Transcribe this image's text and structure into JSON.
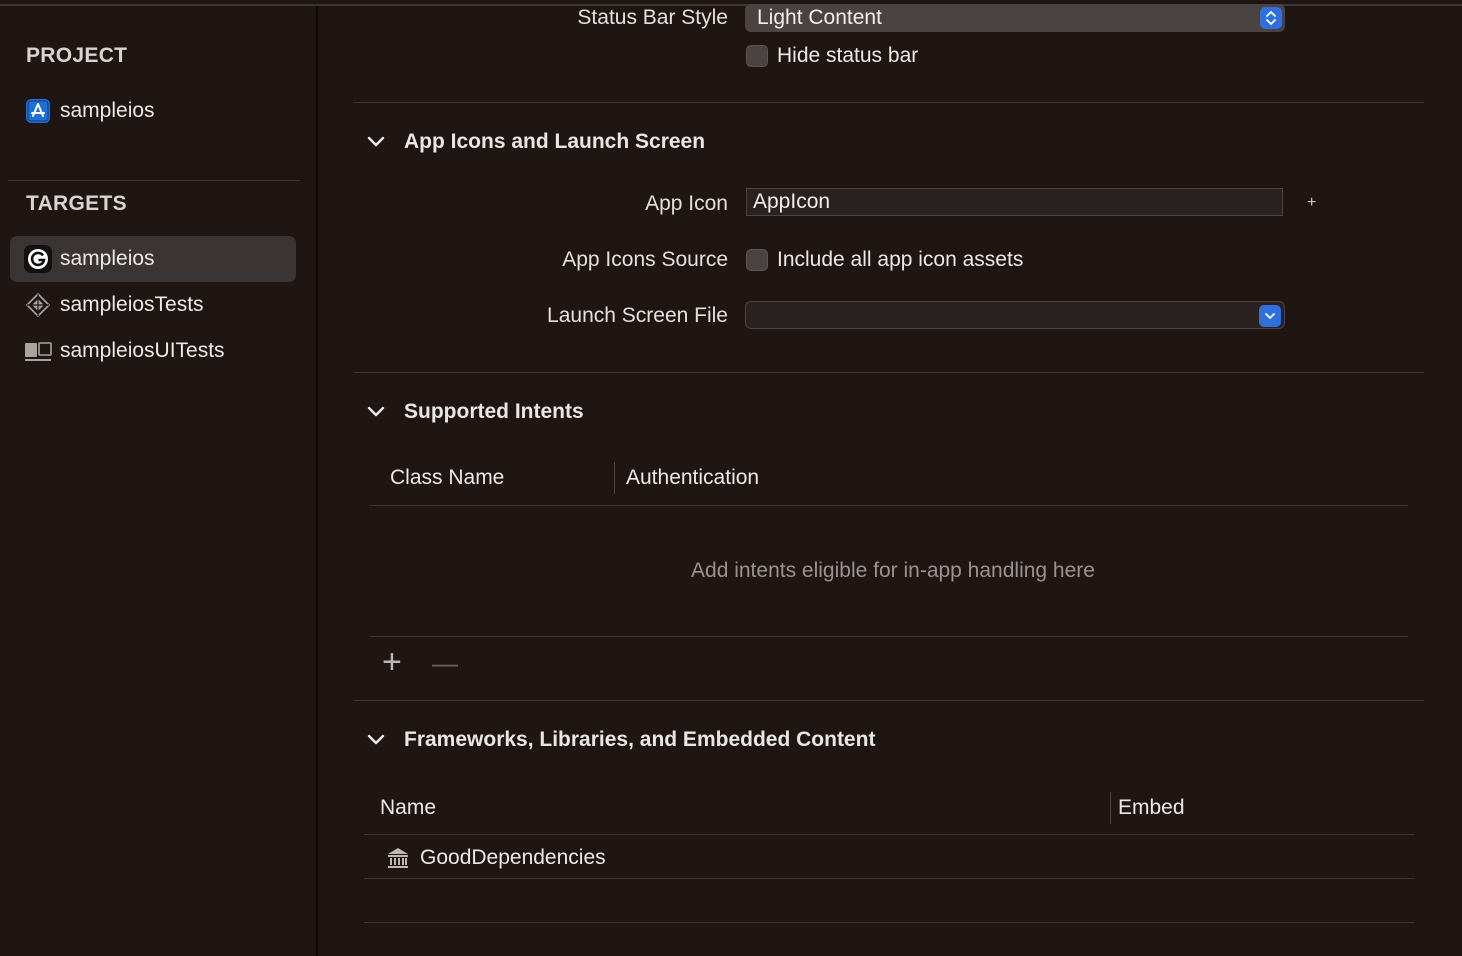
{
  "sidebar": {
    "project_heading": "PROJECT",
    "project_items": [
      {
        "label": "sampleios",
        "icon": "app-store-icon"
      }
    ],
    "targets_heading": "TARGETS",
    "target_items": [
      {
        "label": "sampleios",
        "icon": "g-app-icon",
        "selected": true
      },
      {
        "label": "sampleiosTests",
        "icon": "test-bundle-icon",
        "selected": false
      },
      {
        "label": "sampleiosUITests",
        "icon": "ui-test-bundle-icon",
        "selected": false
      }
    ]
  },
  "deployment": {
    "status_bar_style_label": "Status Bar Style",
    "status_bar_style_value": "Light Content",
    "hide_status_bar_label": "Hide status bar",
    "hide_status_bar_checked": false
  },
  "app_icons": {
    "title": "App Icons and Launch Screen",
    "app_icon_label": "App Icon",
    "app_icon_value": "AppIcon",
    "add_symbol": "+",
    "source_label": "App Icons Source",
    "include_all_label": "Include all app icon assets",
    "include_all_checked": false,
    "launch_screen_label": "Launch Screen File",
    "launch_screen_value": ""
  },
  "intents": {
    "title": "Supported Intents",
    "columns": [
      "Class Name",
      "Authentication"
    ],
    "placeholder": "Add intents eligible for in-app handling here",
    "add_symbol": "+",
    "remove_symbol": "—"
  },
  "frameworks": {
    "title": "Frameworks, Libraries, and Embedded Content",
    "columns": [
      "Name",
      "Embed"
    ],
    "rows": [
      {
        "name": "GoodDependencies",
        "icon": "library-icon",
        "embed": ""
      }
    ]
  },
  "colors": {
    "background": "#1f1614",
    "accent": "#2f6fe0",
    "selection": "#3a3534"
  }
}
